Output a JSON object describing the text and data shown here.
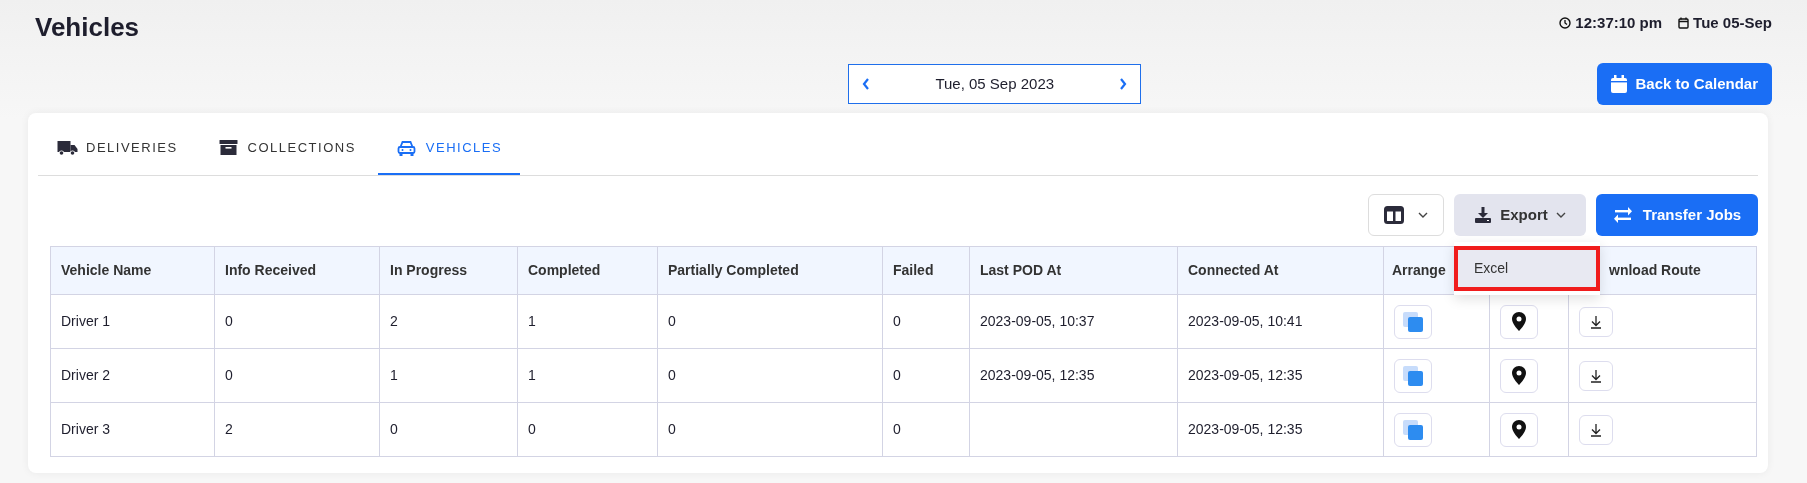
{
  "page": {
    "title": "Vehicles",
    "time": "12:37:10 pm",
    "date": "Tue 05-Sep"
  },
  "date_nav": {
    "label": "Tue, 05 Sep 2023"
  },
  "back_button": {
    "label": "Back to Calendar"
  },
  "tabs": [
    {
      "label": "DELIVERIES",
      "kind": "truck",
      "selected": false
    },
    {
      "label": "COLLECTIONS",
      "kind": "box",
      "selected": false
    },
    {
      "label": "VEHICLES",
      "kind": "car",
      "selected": true
    }
  ],
  "toolbar": {
    "export": {
      "label": "Export",
      "expanded": true,
      "menu": [
        {
          "label": "Excel",
          "highlighted": true
        }
      ]
    },
    "transfer": {
      "label": "Transfer Jobs"
    }
  },
  "table": {
    "columns": [
      "Vehicle Name",
      "Info Received",
      "In Progress",
      "Completed",
      "Partially Completed",
      "Failed",
      "Last POD At",
      "Connected At",
      "Arrange",
      null,
      "wnload Route"
    ],
    "rows": [
      {
        "vehicle_name": "Driver 1",
        "info_received": "0",
        "in_progress": "2",
        "completed": "1",
        "partially_completed": "0",
        "failed": "0",
        "last_pod_at": "2023-09-05, 10:37",
        "connected_at": "2023-09-05, 10:41"
      },
      {
        "vehicle_name": "Driver 2",
        "info_received": "0",
        "in_progress": "1",
        "completed": "1",
        "partially_completed": "0",
        "failed": "0",
        "last_pod_at": "2023-09-05, 12:35",
        "connected_at": "2023-09-05, 12:35"
      },
      {
        "vehicle_name": "Driver 3",
        "info_received": "2",
        "in_progress": "0",
        "completed": "0",
        "partially_completed": "0",
        "failed": "0",
        "connected_at": "2023-09-05, 12:35"
      }
    ]
  }
}
